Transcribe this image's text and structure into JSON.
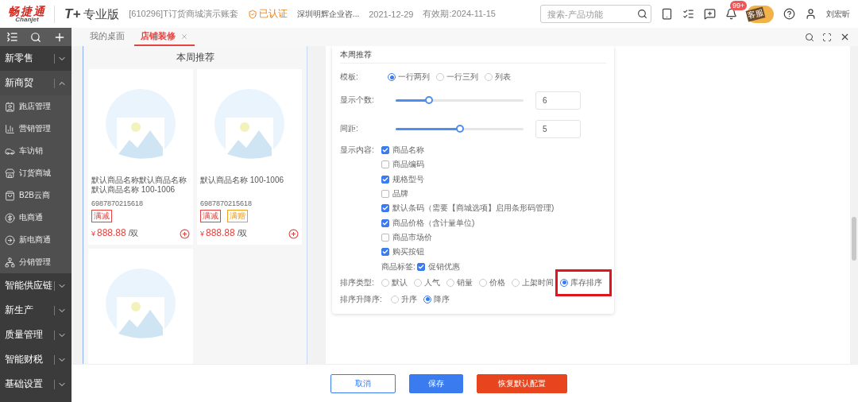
{
  "header": {
    "logo_cn": "畅捷通",
    "logo_en": "Chanjet",
    "product": "T+",
    "edition": "专业版",
    "account": "[610296]T订货商城演示账套",
    "verified": "已认证",
    "company": "深圳明辉企业咨...",
    "date": "2021-12-29",
    "valid": "有效期:2024-11-15",
    "search": {
      "placeholder": "搜索-产品功能"
    },
    "notification_badge": "99+",
    "mascot_sign": "客服",
    "user": "刘宏昕"
  },
  "tabs": [
    {
      "label": "我的桌面",
      "selected": false,
      "closable": false
    },
    {
      "label": "店铺装修",
      "selected": true,
      "closable": true
    }
  ],
  "sidebar": {
    "groups": [
      {
        "label": "新零售",
        "expanded": false
      },
      {
        "label": "新商贸",
        "expanded": true,
        "children": [
          {
            "label": "跑店管理"
          },
          {
            "label": "营销管理"
          },
          {
            "label": "车访销"
          },
          {
            "label": "订货商城"
          },
          {
            "label": "B2B云商"
          },
          {
            "label": "电商通"
          },
          {
            "label": "新电商通"
          },
          {
            "label": "分销管理"
          }
        ]
      },
      {
        "label": "智能供应链",
        "expanded": false
      },
      {
        "label": "新生产",
        "expanded": false
      },
      {
        "label": "质量管理",
        "expanded": false
      },
      {
        "label": "智能财税",
        "expanded": false
      },
      {
        "label": "基础设置",
        "expanded": false
      }
    ]
  },
  "preview": {
    "title": "本周推荐",
    "products": [
      {
        "kind": "full",
        "name": "默认商品名称默认商品名称默认商品名称 100-1006",
        "barcode": "6987870215618",
        "tags": [
          {
            "label": "满减",
            "color": "#e64340"
          }
        ],
        "currency": "¥",
        "price": "888.88",
        "unit": "/双"
      },
      {
        "kind": "full",
        "name": "默认商品名称 100-1006",
        "barcode": "6987870215618",
        "tags": [
          {
            "label": "满减",
            "color": "#e64340"
          },
          {
            "label": "满赠",
            "color": "#f0a020"
          }
        ],
        "currency": "¥",
        "price": "888.88",
        "unit": "/双"
      },
      {
        "kind": "image"
      }
    ]
  },
  "settings": {
    "title": "本周推荐",
    "template": {
      "label": "模板:",
      "options": [
        {
          "label": "一行两列",
          "selected": true
        },
        {
          "label": "一行三列",
          "selected": false
        },
        {
          "label": "列表",
          "selected": false
        }
      ]
    },
    "count": {
      "label": "显示个数:",
      "level": 0.26,
      "value": "6"
    },
    "spacing": {
      "label": "间距:",
      "level": 0.5,
      "value": "5"
    },
    "content": {
      "label": "显示内容:",
      "items": [
        {
          "label": "商品名称",
          "checked": true
        },
        {
          "label": "商品编码",
          "checked": false
        },
        {
          "label": "规格型号",
          "checked": true
        },
        {
          "label": "品牌",
          "checked": false
        },
        {
          "label": "默认条码（需要【商城选项】启用条形码管理)",
          "checked": true
        },
        {
          "label": "商品价格（含计量单位)",
          "checked": true
        },
        {
          "label": "商品市场价",
          "checked": false
        },
        {
          "label": "购买按钮",
          "checked": true
        }
      ]
    },
    "tags": {
      "label": "商品标签:",
      "items": [
        {
          "label": "促销优惠",
          "checked": true
        }
      ]
    },
    "sort_type": {
      "label": "排序类型:",
      "options": [
        {
          "label": "默认",
          "selected": false,
          "highlighted": false
        },
        {
          "label": "人气",
          "selected": false,
          "highlighted": false
        },
        {
          "label": "销量",
          "selected": false,
          "highlighted": false
        },
        {
          "label": "价格",
          "selected": false,
          "highlighted": false
        },
        {
          "label": "上架时间",
          "selected": false,
          "highlighted": false
        },
        {
          "label": "库存排序",
          "selected": true,
          "highlighted": true
        }
      ]
    },
    "sort_order": {
      "label": "排序升降序:",
      "options": [
        {
          "label": "升序",
          "selected": false
        },
        {
          "label": "降序",
          "selected": true
        }
      ]
    }
  },
  "footer": {
    "buttons": [
      {
        "label": "取消",
        "kind": "secondary"
      },
      {
        "label": "保存",
        "kind": "primary"
      },
      {
        "label": "恢复默认配置",
        "kind": "danger"
      }
    ]
  }
}
